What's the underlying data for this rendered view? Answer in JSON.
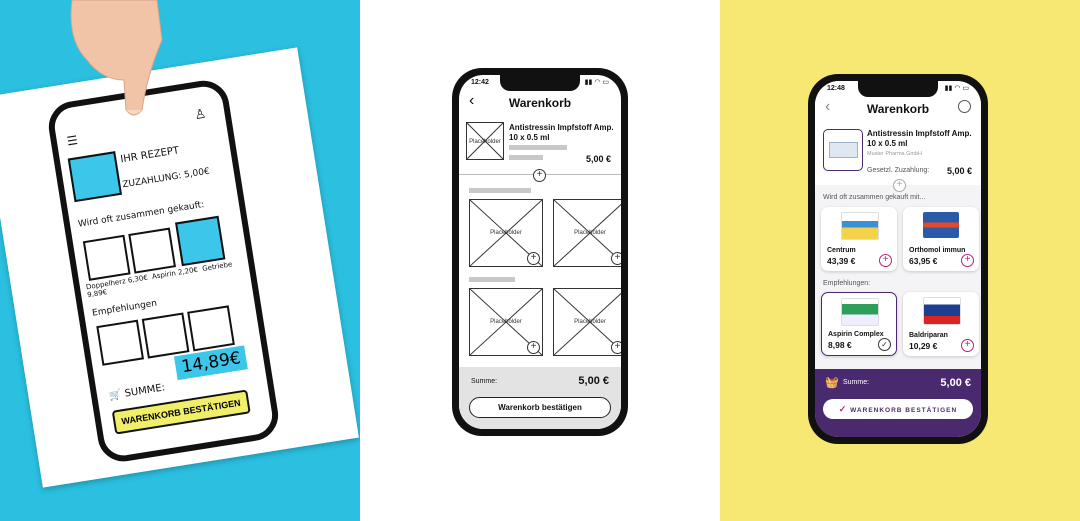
{
  "sketch": {
    "rezept": "IHR REZEPT",
    "zuzahlung": "ZUZAHLUNG: 5,00€",
    "section_oft": "Wird oft zusammen gekauft:",
    "items": [
      "Doppelherz 6,30€",
      "Aspirin 2,20€",
      "Getriebe 9,89€"
    ],
    "section_empf": "Empfehlungen",
    "sum_label": "SUMME:",
    "sum_value": "14,89€",
    "confirm": "WARENKORB BESTÄTIGEN"
  },
  "wireframe": {
    "time": "12:42",
    "title": "Warenkorb",
    "product_name": "Antistressin Impfstoff Amp. 10 x 0.5 ml",
    "product_price": "5,00 €",
    "placeholder": "Placeholder",
    "summe_label": "Summe:",
    "summe_value": "5,00 €",
    "confirm_button": "Warenkorb bestätigen"
  },
  "final": {
    "time": "12:48",
    "title": "Warenkorb",
    "product_name": "Antistressin Impfstoff Amp. 10 x 0.5 ml",
    "product_maker": "Muster Pharma GmbH",
    "zuzahlung_label": "Gesetzl. Zuzahlung:",
    "zuzahlung_value": "5,00 €",
    "section_oft": "Wird oft zusammen gekauft mit...",
    "oft_items": [
      {
        "name": "Centrum",
        "price": "43,39 €"
      },
      {
        "name": "Orthomol immun",
        "price": "63,95 €"
      }
    ],
    "section_empf": "Empfehlungen:",
    "empf_items": [
      {
        "name": "Aspirin Complex",
        "price": "8,98 €"
      },
      {
        "name": "Baldriparan",
        "price": "10,29 €"
      }
    ],
    "summe_label": "Summe:",
    "summe_value": "5,00 €",
    "confirm_button": "WARENKORB BESTÄTIGEN",
    "colors": {
      "accent": "#4a2a6e",
      "plus": "#b3257c"
    }
  }
}
